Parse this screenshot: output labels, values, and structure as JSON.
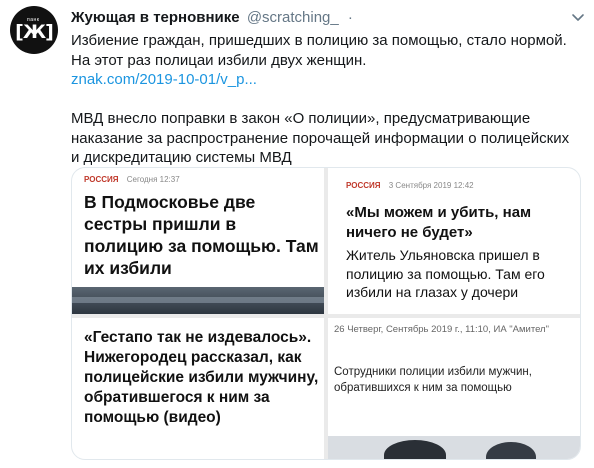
{
  "tweet": {
    "author_name": "Жующая в терновнике",
    "author_handle": "@scratching_",
    "separator": "·",
    "avatar": {
      "top_text": "панк",
      "logo_text": "[Ж]"
    },
    "icons": {
      "more": "chevron-down-icon"
    },
    "text": {
      "line1": "Избиение граждан, пришедших в полицию за помощью, стало нормой.",
      "line2": "На этот раз полицаи избили двух женщин.",
      "link": "znak.com/2019-10-01/v_p...",
      "line3": "МВД внесло поправки в закон «О полиции», предусматривающие",
      "line4": "наказание за распространение порочащей информации о полицейских",
      "line5": "и дискредитацию системы МВД"
    }
  },
  "media": {
    "card1": {
      "section": "РОССИЯ",
      "time": "Сегодня 12:37",
      "headline": "В Подмосковье две сестры пришли в полицию за помощью. Там их избили"
    },
    "card2": {
      "section": "РОССИЯ",
      "time": "3 Сентября 2019 12:42",
      "quote": "«Мы можем и убить, нам ничего не будет»",
      "subtitle": "Житель Ульяновска пришел в полицию за помощью. Там его избили на глазах у дочери"
    },
    "card3": {
      "headline": "«Гестапо так не издевалось». Нижегородец рассказал, как полицейские избили мужчину, обратившегося к ним за помощью (видео)"
    },
    "card4": {
      "meta": "26 Четверг, Сентябрь 2019 г., 11:10, ИА \"Амител\"",
      "text": "Сотрудники полиции избили мужчин, обратившихся к ним за помощью"
    }
  }
}
